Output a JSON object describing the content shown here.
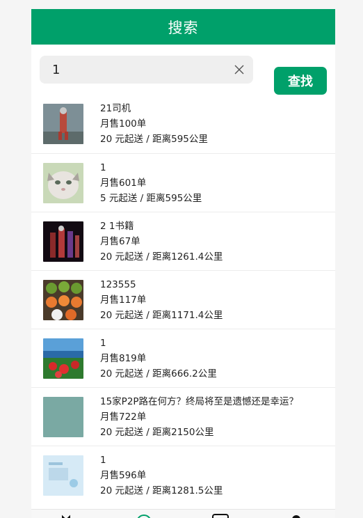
{
  "header": {
    "title": "搜索"
  },
  "search": {
    "value": "1",
    "button_label": "查找"
  },
  "results": [
    {
      "name": "21司机",
      "sales": "月售100单",
      "delivery": "20 元起送 / 距离595公里"
    },
    {
      "name": "1",
      "sales": "月售601单",
      "delivery": "5 元起送 / 距离595公里"
    },
    {
      "name": "2 1书籍",
      "sales": "月售67单",
      "delivery": "20 元起送 / 距离1261.4公里"
    },
    {
      "name": "123555",
      "sales": "月售117单",
      "delivery": "20 元起送 / 距离1171.4公里"
    },
    {
      "name": "1",
      "sales": "月售819单",
      "delivery": "20 元起送 / 距离666.2公里"
    },
    {
      "name": "15家P2P路在何方？终局将至是遗憾还是幸运？",
      "sales": "月售722单",
      "delivery": "20 元起送 / 距离2150公里"
    },
    {
      "name": "1",
      "sales": "月售596单",
      "delivery": "20 元起送 / 距离1281.5公里"
    }
  ],
  "tabbar": {
    "icons": [
      "home-icon",
      "discover-icon",
      "order-icon",
      "profile-icon"
    ]
  }
}
